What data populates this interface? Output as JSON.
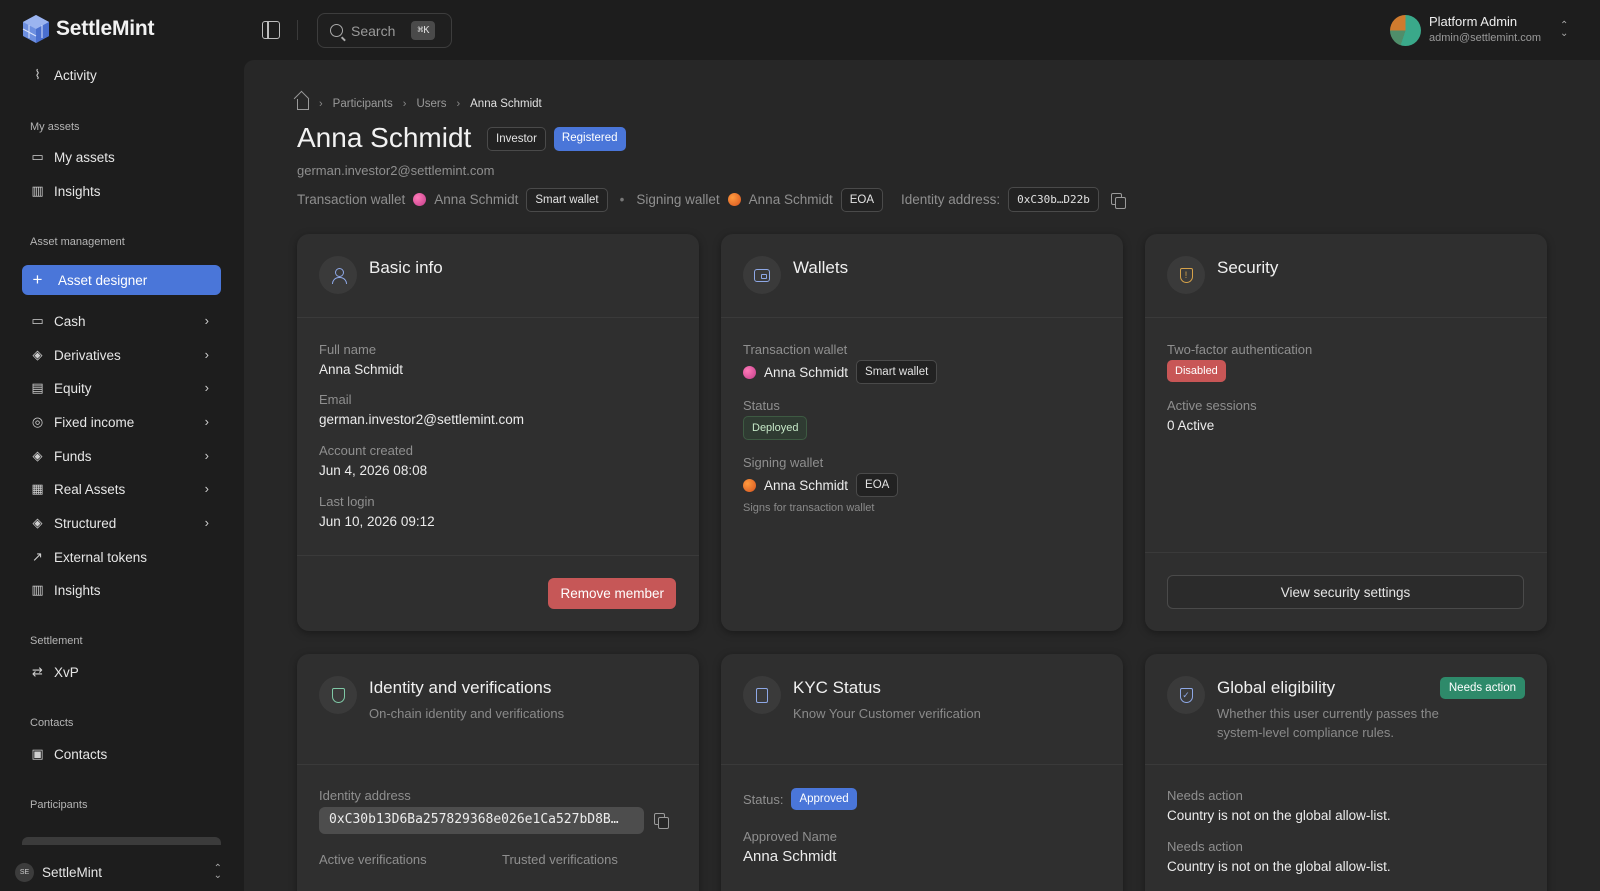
{
  "brand": {
    "name": "SettleMint"
  },
  "topbar": {
    "search_label": "Search",
    "search_shortcut": "⌘K",
    "user_name": "Platform Admin",
    "user_email": "admin@settlemint.com"
  },
  "sidebar": {
    "activity": "Activity",
    "sections": {
      "my_assets": "My assets",
      "asset_management": "Asset management",
      "settlement": "Settlement",
      "contacts": "Contacts",
      "participants": "Participants"
    },
    "items": {
      "my_assets": "My assets",
      "insights_top": "Insights",
      "asset_designer": "Asset designer",
      "cash": "Cash",
      "derivatives": "Derivatives",
      "equity": "Equity",
      "fixed_income": "Fixed income",
      "funds": "Funds",
      "real_assets": "Real Assets",
      "structured": "Structured",
      "external_tokens": "External tokens",
      "insights": "Insights",
      "xvp": "XvP",
      "contacts": "Contacts"
    },
    "footer": {
      "badge": "SE",
      "label": "SettleMint"
    }
  },
  "breadcrumb": [
    "Participants",
    "Users",
    "Anna Schmidt"
  ],
  "header": {
    "title": "Anna Schmidt",
    "badges": [
      "Investor",
      "Registered"
    ],
    "email": "german.investor2@settlemint.com",
    "transaction_wallet_label": "Transaction wallet",
    "transaction_wallet_name": "Anna Schmidt",
    "transaction_wallet_type": "Smart wallet",
    "signing_wallet_label": "Signing wallet",
    "signing_wallet_name": "Anna Schmidt",
    "signing_wallet_type": "EOA",
    "identity_label": "Identity address:",
    "identity_short": "0xC30b…D22b"
  },
  "cards": {
    "basic_info": {
      "title": "Basic info",
      "full_name_label": "Full name",
      "full_name": "Anna Schmidt",
      "email_label": "Email",
      "email": "german.investor2@settlemint.com",
      "created_label": "Account created",
      "created": "Jun 4, 2026 08:08",
      "last_login_label": "Last login",
      "last_login": "Jun 10, 2026 09:12",
      "remove_button": "Remove member"
    },
    "wallets": {
      "title": "Wallets",
      "tx_label": "Transaction wallet",
      "tx_name": "Anna Schmidt",
      "tx_type": "Smart wallet",
      "status_label": "Status",
      "status": "Deployed",
      "signing_label": "Signing wallet",
      "signing_name": "Anna Schmidt",
      "signing_type": "EOA",
      "signing_note": "Signs for transaction wallet"
    },
    "security": {
      "title": "Security",
      "twofa_label": "Two-factor authentication",
      "twofa_status": "Disabled",
      "sessions_label": "Active sessions",
      "sessions": "0 Active",
      "button": "View security settings"
    },
    "identity": {
      "title": "Identity and verifications",
      "desc": "On-chain identity and verifications",
      "address_label": "Identity address",
      "address": "0xC30b13D6Ba257829368e026e1Ca527bD8B…",
      "active_label": "Active verifications",
      "trusted_label": "Trusted verifications"
    },
    "kyc": {
      "title": "KYC Status",
      "desc": "Know Your Customer verification",
      "status_label": "Status:",
      "status": "Approved",
      "approved_name_label": "Approved Name",
      "approved_name": "Anna Schmidt"
    },
    "eligibility": {
      "title": "Global eligibility",
      "badge": "Needs action",
      "desc": "Whether this user currently passes the system-level compliance rules.",
      "items": [
        {
          "label": "Needs action",
          "text": "Country is not on the global allow-list."
        },
        {
          "label": "Needs action",
          "text": "Country is not on the global allow-list."
        }
      ]
    }
  },
  "colors": {
    "accent": "#4a76d9",
    "danger": "#c65757",
    "success": "#2e8a6a"
  }
}
